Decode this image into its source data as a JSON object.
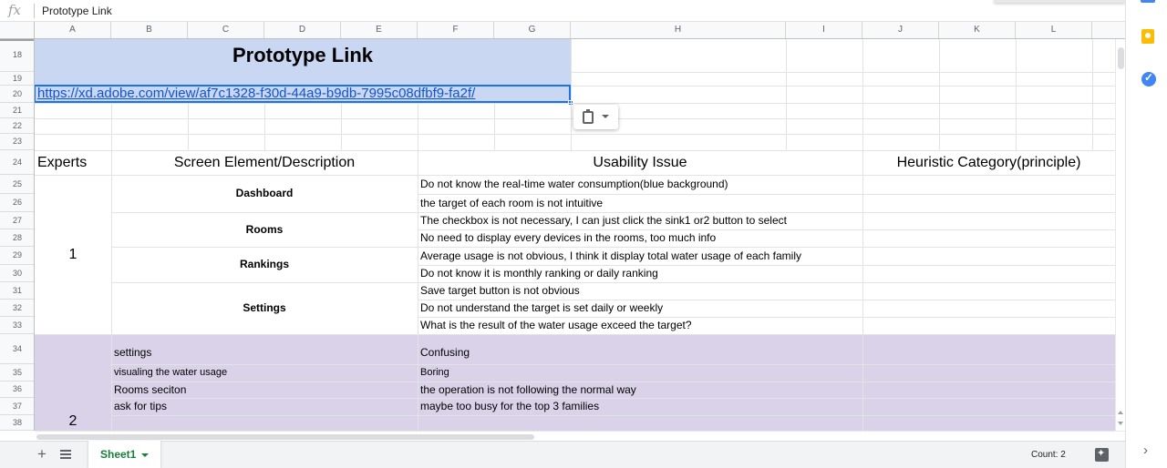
{
  "formula_bar": {
    "fx_label": "fx",
    "content": "Prototype Link"
  },
  "columns": [
    "A",
    "B",
    "C",
    "D",
    "E",
    "F",
    "G",
    "H",
    "I",
    "J",
    "K",
    "L"
  ],
  "rows": [
    "18",
    "19",
    "20",
    "21",
    "22",
    "23",
    "24",
    "25",
    "26",
    "27",
    "28",
    "29",
    "30",
    "31",
    "32",
    "33",
    "34",
    "35",
    "36",
    "37",
    "38"
  ],
  "cells": {
    "title": "Prototype Link",
    "link": "https://xd.adobe.com/view/af7c1328-f30d-44a9-b9db-7995c08dfbf9-fa2f/",
    "headers": {
      "experts": "Experts",
      "screen": "Screen Element/Description",
      "issue": "Usability Issue",
      "heuristic": "Heuristic Category(principle)"
    },
    "expert_1": "1",
    "expert_2": "2",
    "sections": [
      "Dashboard",
      "Rooms",
      "Rankings",
      "Settings"
    ],
    "issues": [
      "Do not know the real-time water consumption(blue background)",
      "the target of each room is not intuitive",
      "The checkbox is not necessary, I can just click the sink1 or2 button to select",
      "No need to display every devices in the rooms, too much info",
      "Average usage is not obvious, I think it display total water usage of each family",
      "Do not know it is monthly ranking or daily ranking",
      "Save target button is not obvious",
      "Do not understand the target is set daily or weekly",
      "What is the result of the water usage exceed the target?"
    ],
    "expert2_rows": [
      {
        "element": "settings",
        "issue": "Confusing"
      },
      {
        "element": "visualing the water usage",
        "issue": "Boring"
      },
      {
        "element": "Rooms seciton",
        "issue": "the operation is not following the normal way"
      },
      {
        "element": "ask for tips",
        "issue": "maybe too busy for the top 3 families"
      }
    ]
  },
  "colors": {
    "header_fill": "#c9d7f3",
    "expert2_fill": "#d9d2e9",
    "link": "#1155cc",
    "selection": "#1a73e8",
    "sheet_tab": "#188038"
  },
  "sheet_tabs": [
    {
      "label": "Sheet1",
      "active": true
    }
  ],
  "status": {
    "count": "Count: 2"
  },
  "icons": [
    "paste-icon",
    "add-sheet-icon",
    "all-sheets-icon",
    "explore-icon",
    "keep-icon",
    "tasks-icon",
    "chevron-right-icon"
  ]
}
